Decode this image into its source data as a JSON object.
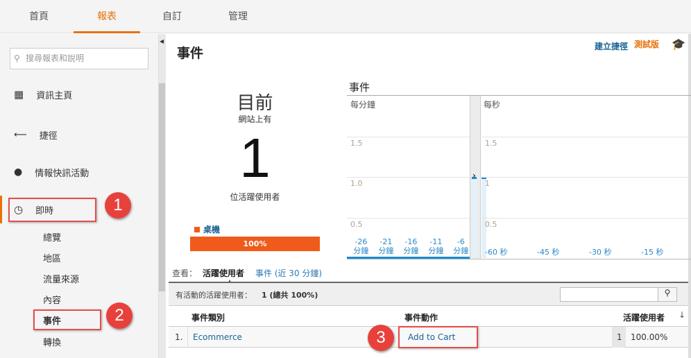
{
  "topnav": {
    "tabs": [
      "首頁",
      "報表",
      "自訂",
      "管理"
    ],
    "active": "報表"
  },
  "sidebar": {
    "search_placeholder": "搜尋報表和說明",
    "items": [
      {
        "label": "資訊主頁",
        "icon": "grid-icon"
      },
      {
        "label": "捷徑",
        "icon": "shortcut-arrow-icon"
      },
      {
        "label": "情報快訊活動",
        "icon": "lightbulb-icon"
      },
      {
        "label": "即時",
        "icon": "clock-icon"
      }
    ],
    "subitems": [
      "總覽",
      "地區",
      "流量來源",
      "內容",
      "事件",
      "轉換"
    ],
    "callouts": [
      "1",
      "2",
      "3"
    ]
  },
  "header": {
    "title": "事件",
    "shortcut": "建立捷徑",
    "beta": "測試版"
  },
  "summary": {
    "now": "目前",
    "on_site": "網站上有",
    "count": "1",
    "active_users": "位活躍使用者",
    "device": "桌機",
    "device_percent": "100%",
    "device_share": 100
  },
  "chart": {
    "title": "事件",
    "per_minute": "每分鐘",
    "per_second": "每秒"
  },
  "chart_data": [
    {
      "type": "bar",
      "title": "每分鐘",
      "y_ticks": [
        "1.5",
        "1.0",
        "0.5"
      ],
      "ylim": [
        0,
        1.5
      ],
      "x_tick_labels": [
        "-26 分鐘",
        "-21 分鐘",
        "-16 分鐘",
        "-11 分鐘",
        "-6 分鐘"
      ],
      "x_ticks": [
        -26,
        -21,
        -16,
        -11,
        -6
      ],
      "x": [
        -5,
        -3
      ],
      "values": [
        1,
        1
      ],
      "color": "#1a8ad0"
    },
    {
      "type": "bar",
      "title": "每秒",
      "y_ticks": [
        "1.5",
        "1",
        "0.5"
      ],
      "ylim": [
        0,
        1.5
      ],
      "x_tick_labels": [
        "-60 秒",
        "-45 秒",
        "-30 秒",
        "-15 秒"
      ],
      "values": []
    }
  ],
  "view": {
    "label": "查看：",
    "active": "活躍使用者",
    "other": "事件 (近 30 分鐘)"
  },
  "table": {
    "summary_label": "有活動的活躍使用者：",
    "summary_value": "1 (總共 100%)",
    "columns": [
      "事件類別",
      "事件動作",
      "活躍使用者"
    ],
    "rows": [
      {
        "index": "1.",
        "category": "Ecommerce",
        "action": "Add to Cart",
        "users": "1",
        "percent": "100.00%"
      }
    ]
  },
  "colors": {
    "accent": "#e8710a",
    "link": "#1a6496",
    "callout": "#e8413c",
    "bar": "#f05a1a"
  }
}
